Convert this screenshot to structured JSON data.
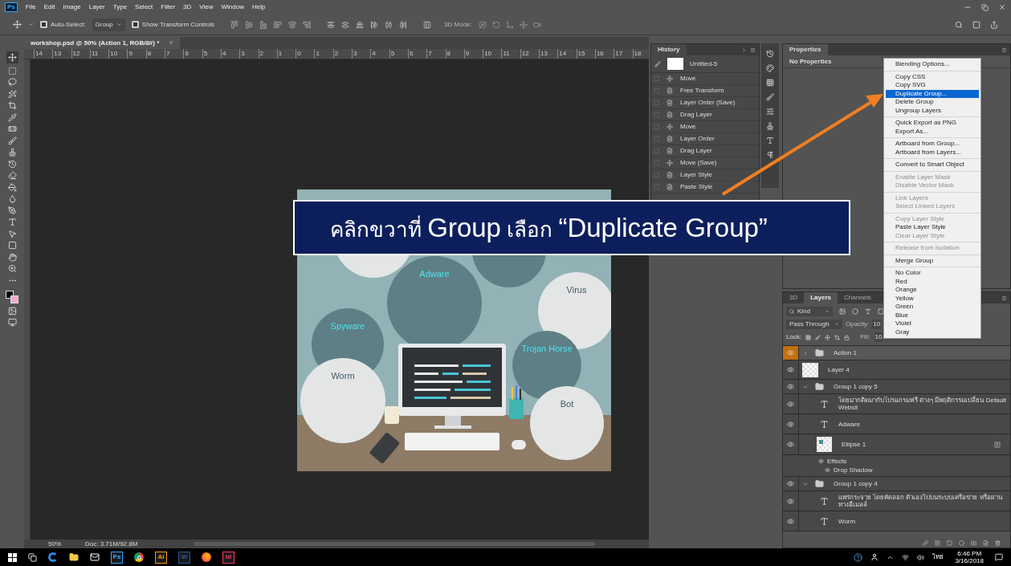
{
  "app_logo": "Ps",
  "menu_bar": [
    "File",
    "Edit",
    "Image",
    "Layer",
    "Type",
    "Select",
    "Filter",
    "3D",
    "View",
    "Window",
    "Help"
  ],
  "options_bar": {
    "auto_select": {
      "label": "Auto-Select:",
      "checked": true
    },
    "select_target": "Group",
    "transform_controls": {
      "label": "Show Transform Controls",
      "checked": true
    },
    "mode_3d": "3D Mode:"
  },
  "document_tab": {
    "title": "workshop.psd @ 50% (Action 1, RGB/8#) *",
    "close": "×"
  },
  "ruler_labels": [
    "14",
    "13",
    "12",
    "11",
    "10",
    "9",
    "8",
    "7",
    "6",
    "5",
    "4",
    "3",
    "2",
    "1",
    "0",
    "1",
    "2",
    "3",
    "4",
    "5",
    "6",
    "7",
    "8",
    "9",
    "10",
    "11",
    "12",
    "13",
    "14",
    "15",
    "16",
    "17",
    "18"
  ],
  "artwork": {
    "circles": [
      {
        "text": "Adware",
        "kind": "dark"
      },
      {
        "text": "Spyware",
        "kind": "dark"
      },
      {
        "text": "Virus",
        "kind": "light"
      },
      {
        "text": "Trojan Horse",
        "kind": "dark"
      },
      {
        "text": "Worm",
        "kind": "light"
      },
      {
        "text": "Bot",
        "kind": "light"
      }
    ]
  },
  "history": {
    "title": "History",
    "snapshot": "Untitled-5",
    "steps": [
      {
        "label": "Move",
        "kind": "move"
      },
      {
        "label": "Free Transform",
        "kind": "doc"
      },
      {
        "label": "Layer Order (Save)",
        "kind": "doc"
      },
      {
        "label": "Drag Layer",
        "kind": "doc"
      },
      {
        "label": "Move",
        "kind": "move"
      },
      {
        "label": "Layer Order",
        "kind": "doc"
      },
      {
        "label": "Drag Layer",
        "kind": "doc"
      },
      {
        "label": "Move (Save)",
        "kind": "move"
      },
      {
        "label": "Layer Style",
        "kind": "doc"
      },
      {
        "label": "Paste Style",
        "kind": "doc"
      }
    ]
  },
  "properties": {
    "title": "Properties",
    "message": "No Properties"
  },
  "layers_panel": {
    "tabs": [
      {
        "label": "3D",
        "selected": false
      },
      {
        "label": "Layers",
        "selected": true
      },
      {
        "label": "Channels",
        "selected": false
      }
    ],
    "filter": "Kind",
    "blend_mode": "Pass Through",
    "opacity_label": "Opacity:",
    "opacity_value": "10",
    "lock_label": "Lock:",
    "fill_label": "Fill:",
    "fill_value": "10",
    "layers": [
      {
        "name": "Action 1",
        "kind": "group",
        "selected": true,
        "expanded": false,
        "visible": true
      },
      {
        "name": "Layer 4",
        "kind": "pixel",
        "selected": false,
        "visible": true
      },
      {
        "name": "Group 1 copy 5",
        "kind": "group",
        "selected": false,
        "expanded": true,
        "visible": true,
        "children": [
          {
            "name": "โดยมากติดมากับโปรแกรมฟรี ต่างๆ มีพฤติกรรมเปลี่ยน Default Websit",
            "kind": "text",
            "selected": false,
            "visible": true
          },
          {
            "name": "Adware",
            "kind": "text",
            "selected": false,
            "visible": true
          },
          {
            "name": "Ellipse 1",
            "kind": "shape",
            "selected": false,
            "visible": true,
            "effects": [
              "Effects",
              "Drop Shadow"
            ]
          }
        ]
      },
      {
        "name": "Group 1 copy 4",
        "kind": "group",
        "selected": false,
        "expanded": true,
        "visible": true,
        "children": [
          {
            "name": "แพร่กระจาย โดยคัดลอก ตัวเองไปบนระบบเครือข่าย หรือผ่านทางอีเมลล์",
            "kind": "text",
            "selected": false,
            "visible": true
          },
          {
            "name": "Worm",
            "kind": "text",
            "selected": false,
            "visible": true
          }
        ]
      }
    ]
  },
  "status_bar": {
    "zoom": "50%",
    "doc_size": "Doc: 3.71M/92.8M"
  },
  "context_menu": {
    "sections": [
      [
        {
          "label": "Blending Options...",
          "disabled": false,
          "selected": false
        }
      ],
      [
        {
          "label": "Copy CSS",
          "disabled": false,
          "selected": false
        },
        {
          "label": "Copy SVG",
          "disabled": false,
          "selected": false
        },
        {
          "label": "Duplicate Group...",
          "disabled": false,
          "selected": true
        },
        {
          "label": "Delete Group",
          "disabled": false,
          "selected": false
        },
        {
          "label": "Ungroup Layers",
          "disabled": false,
          "selected": false
        }
      ],
      [
        {
          "label": "Quick Export as PNG",
          "disabled": false,
          "selected": false
        },
        {
          "label": "Export As...",
          "disabled": false,
          "selected": false
        }
      ],
      [
        {
          "label": "Artboard from Group...",
          "disabled": false,
          "selected": false
        },
        {
          "label": "Artboard from Layers...",
          "disabled": false,
          "selected": false
        }
      ],
      [
        {
          "label": "Convert to Smart Object",
          "disabled": false,
          "selected": false
        }
      ],
      [
        {
          "label": "Enable Layer Mask",
          "disabled": true,
          "selected": false
        },
        {
          "label": "Disable Vector Mask",
          "disabled": true,
          "selected": false
        }
      ],
      [
        {
          "label": "Link Layers",
          "disabled": true,
          "selected": false
        },
        {
          "label": "Select Linked Layers",
          "disabled": true,
          "selected": false
        }
      ],
      [
        {
          "label": "Copy Layer Style",
          "disabled": true,
          "selected": false
        },
        {
          "label": "Paste Layer Style",
          "disabled": false,
          "selected": false
        },
        {
          "label": "Clear Layer Style",
          "disabled": true,
          "selected": false
        }
      ],
      [
        {
          "label": "Release from Isolation",
          "disabled": true,
          "selected": false
        }
      ],
      [
        {
          "label": "Merge Group",
          "disabled": false,
          "selected": false
        }
      ],
      [
        {
          "label": "No Color",
          "disabled": false,
          "selected": false
        },
        {
          "label": "Red",
          "disabled": false,
          "selected": false
        },
        {
          "label": "Orange",
          "disabled": false,
          "selected": false
        },
        {
          "label": "Yellow",
          "disabled": false,
          "selected": false
        },
        {
          "label": "Green",
          "disabled": false,
          "selected": false
        },
        {
          "label": "Blue",
          "disabled": false,
          "selected": false
        },
        {
          "label": "Violet",
          "disabled": false,
          "selected": false
        },
        {
          "label": "Gray",
          "disabled": false,
          "selected": false
        }
      ]
    ]
  },
  "caption": [
    {
      "text": "คลิกขวาที่ ",
      "kind": "thai"
    },
    {
      "text": "Group",
      "kind": "latin"
    },
    {
      "text": " เลือก ",
      "kind": "thai"
    },
    {
      "text": "“Duplicate Group”",
      "kind": "latin"
    }
  ],
  "taskbar": {
    "apps": [
      {
        "kind": "task-view"
      },
      {
        "kind": "edge"
      },
      {
        "kind": "folder"
      },
      {
        "kind": "mail"
      },
      {
        "kind": "app",
        "label": "Ps",
        "color": "#31a8ff"
      },
      {
        "kind": "chrome"
      },
      {
        "kind": "app",
        "label": "Ai",
        "color": "#ff9a00"
      },
      {
        "kind": "app",
        "label": "W",
        "color": "#2b5797"
      },
      {
        "kind": "firefox"
      },
      {
        "kind": "app",
        "label": "Id",
        "color": "#ff3366"
      }
    ],
    "language": "ไทย",
    "time": "6:46 PM",
    "date": "3/16/2018"
  }
}
